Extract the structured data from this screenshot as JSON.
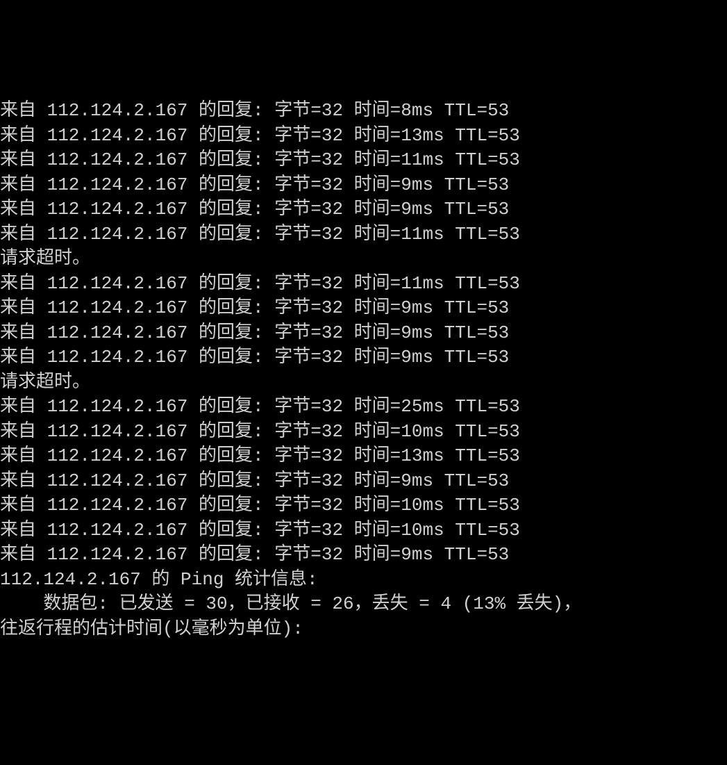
{
  "ip": "112.124.2.167",
  "reply_prefix": "来自 ",
  "reply_mid": " 的回复: ",
  "bytes_label": "字节=",
  "bytes_value": "32",
  "time_label": " 时间=",
  "ttl_label": " TTL=",
  "ttl_value": "53",
  "timeout_text": "请求超时。",
  "lines": [
    {
      "type": "reply",
      "time": "8ms"
    },
    {
      "type": "reply",
      "time": "13ms"
    },
    {
      "type": "reply",
      "time": "11ms"
    },
    {
      "type": "reply",
      "time": "9ms"
    },
    {
      "type": "reply",
      "time": "9ms"
    },
    {
      "type": "reply",
      "time": "11ms"
    },
    {
      "type": "timeout"
    },
    {
      "type": "reply",
      "time": "11ms"
    },
    {
      "type": "reply",
      "time": "9ms"
    },
    {
      "type": "reply",
      "time": "9ms"
    },
    {
      "type": "reply",
      "time": "9ms"
    },
    {
      "type": "timeout"
    },
    {
      "type": "reply",
      "time": "25ms"
    },
    {
      "type": "reply",
      "time": "10ms"
    },
    {
      "type": "reply",
      "time": "13ms"
    },
    {
      "type": "reply",
      "time": "9ms"
    },
    {
      "type": "reply",
      "time": "10ms"
    },
    {
      "type": "reply",
      "time": "10ms"
    },
    {
      "type": "reply",
      "time": "9ms"
    }
  ],
  "blank": "",
  "stats_header_prefix": "",
  "stats_header_mid": " 的 Ping 统计信息:",
  "packets_line": "    数据包: 已发送 = 30，已接收 = 26，丢失 = 4 (13% 丢失)，",
  "rtt_line": "往返行程的估计时间(以毫秒为单位):"
}
